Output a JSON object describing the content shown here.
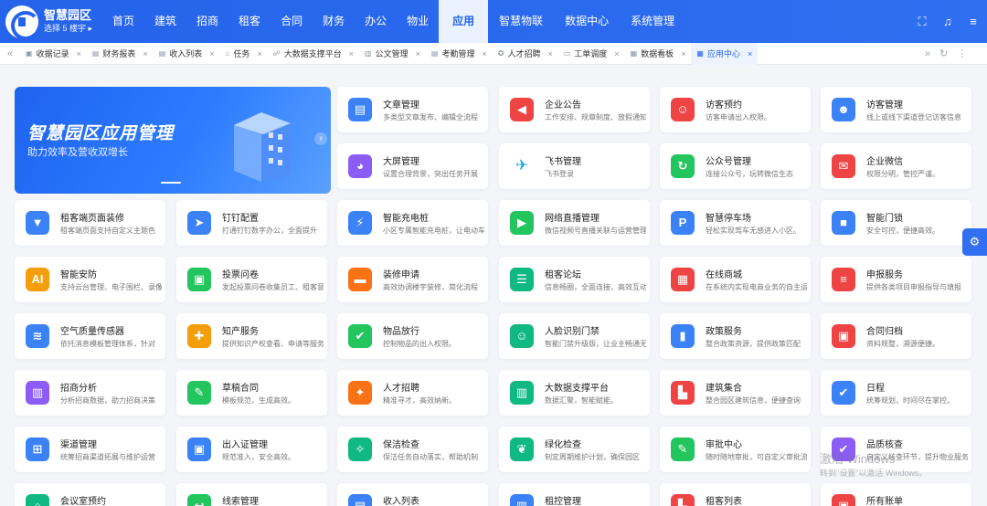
{
  "brand": {
    "title": "智慧园区",
    "subtitle": "选择 5 楼宇 ▸"
  },
  "nav": [
    "首页",
    "建筑",
    "招商",
    "租客",
    "合同",
    "财务",
    "办公",
    "物业",
    "应用",
    "智慧物联",
    "数据中心",
    "系统管理"
  ],
  "nav_active": "应用",
  "tabs": [
    {
      "icon": "▣",
      "label": "收据记录"
    },
    {
      "icon": "▤",
      "label": "财务报表"
    },
    {
      "icon": "▤",
      "label": "收入列表"
    },
    {
      "icon": "⌂",
      "label": "任务"
    },
    {
      "icon": "☍",
      "label": "大数据支撑平台"
    },
    {
      "icon": "▥",
      "label": "公文管理"
    },
    {
      "icon": "▤",
      "label": "考勤管理"
    },
    {
      "icon": "✪",
      "label": "人才招聘"
    },
    {
      "icon": "▭",
      "label": "工单调度"
    },
    {
      "icon": "▦",
      "label": "数据看板"
    },
    {
      "icon": "▦",
      "label": "应用中心",
      "active": true
    }
  ],
  "banner": {
    "title": "智慧园区应用管理",
    "subtitle": "助力效率及营收双增长"
  },
  "cards": [
    {
      "title": "文章管理",
      "desc": "多类型文章发布、编辑全流程",
      "color": "#3b82f6",
      "icon": "book-icon",
      "glyph": "▤"
    },
    {
      "title": "企业公告",
      "desc": "工作安排、规章制度、放假通知",
      "color": "#ef4444",
      "icon": "megaphone-icon",
      "glyph": "◀"
    },
    {
      "title": "访客预约",
      "desc": "访客申请出入权限。",
      "color": "#ef4444",
      "icon": "visitor-icon",
      "glyph": "☺"
    },
    {
      "title": "访客管理",
      "desc": "线上或线下渠道登记访客信息",
      "color": "#3b82f6",
      "icon": "visitor-manage-icon",
      "glyph": "☻"
    },
    {
      "title": "大屏管理",
      "desc": "设置合理背景，突出任务开展",
      "color": "#8b5cf6",
      "icon": "palette-icon",
      "glyph": "◕"
    },
    {
      "title": "飞书管理",
      "desc": "飞书登录",
      "color": "#ffffff",
      "icon": "feishu-icon",
      "glyph": "✈"
    },
    {
      "title": "公众号管理",
      "desc": "连接公众号，玩转微信生态",
      "color": "#22c55e",
      "icon": "wechat-official-icon",
      "glyph": "↻"
    },
    {
      "title": "企业微信",
      "desc": "权限分明，管控严谨。",
      "color": "#ef4444",
      "icon": "wecom-icon",
      "glyph": "✉"
    },
    {
      "title": "租客端页面装修",
      "desc": "租客端页面支持自定义主题色",
      "color": "#3b82f6",
      "icon": "brush-icon",
      "glyph": "▼"
    },
    {
      "title": "钉钉配置",
      "desc": "打通钉钉数字办公，全面提升",
      "color": "#3b82f6",
      "icon": "dingtalk-icon",
      "glyph": "➤"
    },
    {
      "title": "智能充电桩",
      "desc": "小区专属智能充电桩，让电动车",
      "color": "#3b82f6",
      "icon": "charger-icon",
      "glyph": "⚡"
    },
    {
      "title": "网络直播管理",
      "desc": "微信视频号直播关联与运营管理",
      "color": "#22c55e",
      "icon": "live-icon",
      "glyph": "▶"
    },
    {
      "title": "智慧停车场",
      "desc": "轻松实现驾车无感进入小区。",
      "color": "#3b82f6",
      "icon": "parking-icon",
      "glyph": "P"
    },
    {
      "title": "智能门锁",
      "desc": "安全可控，便捷高效。",
      "color": "#3b82f6",
      "icon": "lock-icon",
      "glyph": "■"
    },
    {
      "title": "智能安防",
      "desc": "支持云台管理、电子围栏、录像",
      "color": "#f59e0b",
      "icon": "security-icon",
      "glyph": "AI"
    },
    {
      "title": "投票问卷",
      "desc": "发起投票问卷收集员工、租客意见",
      "color": "#22c55e",
      "icon": "vote-icon",
      "glyph": "▣"
    },
    {
      "title": "装修申请",
      "desc": "高效协调楼宇装修，简化流程",
      "color": "#f97316",
      "icon": "paint-roller-icon",
      "glyph": "▬"
    },
    {
      "title": "租客论坛",
      "desc": "信息畅圈，全面连接，高效互动",
      "color": "#10b981",
      "icon": "forum-icon",
      "glyph": "☰"
    },
    {
      "title": "在线商城",
      "desc": "在系统内实现电商业务的自主运营",
      "color": "#ef4444",
      "icon": "shop-icon",
      "glyph": "▦"
    },
    {
      "title": "申报服务",
      "desc": "提供各类项目申报指导与填报",
      "color": "#ef4444",
      "icon": "declare-icon",
      "glyph": "≡"
    },
    {
      "title": "空气质量传感器",
      "desc": "依托消息模板管理体系，针对",
      "color": "#3b82f6",
      "icon": "air-sensor-icon",
      "glyph": "≋"
    },
    {
      "title": "知产服务",
      "desc": "提供知识产权查看、申请等服务",
      "color": "#f59e0b",
      "icon": "ip-service-icon",
      "glyph": "✚"
    },
    {
      "title": "物品放行",
      "desc": "控制物品的出入权限。",
      "color": "#22c55e",
      "icon": "release-icon",
      "glyph": "✔"
    },
    {
      "title": "人脸识别门禁",
      "desc": "智能门禁升级版，让业主畅通无阻",
      "color": "#10b981",
      "icon": "face-id-icon",
      "glyph": "☺"
    },
    {
      "title": "政策服务",
      "desc": "整合政策资源，提供政策匹配",
      "color": "#3b82f6",
      "icon": "policy-icon",
      "glyph": "▮"
    },
    {
      "title": "合同归档",
      "desc": "资料规整，溯源便捷。",
      "color": "#ef4444",
      "icon": "archive-icon",
      "glyph": "▣"
    },
    {
      "title": "招商分析",
      "desc": "分析招商数据，助力招商决策",
      "color": "#8b5cf6",
      "icon": "analysis-icon",
      "glyph": "▥"
    },
    {
      "title": "草稿合同",
      "desc": "模板规范，生成高效。",
      "color": "#22c55e",
      "icon": "draft-icon",
      "glyph": "✎"
    },
    {
      "title": "人才招聘",
      "desc": "精准寻才，高效纳新。",
      "color": "#f97316",
      "icon": "recruit-icon",
      "glyph": "✦"
    },
    {
      "title": "大数据支撑平台",
      "desc": "数据汇聚，智能赋能。",
      "color": "#10b981",
      "icon": "bigdata-icon",
      "glyph": "▥"
    },
    {
      "title": "建筑集合",
      "desc": "整合园区建筑信息，便捷查询",
      "color": "#ef4444",
      "icon": "building-icon",
      "glyph": "▙"
    },
    {
      "title": "日程",
      "desc": "统筹规划，时间尽在掌控。",
      "color": "#3b82f6",
      "icon": "calendar-icon",
      "glyph": "✔"
    },
    {
      "title": "渠道管理",
      "desc": "统筹招商渠道拓展与维护运营",
      "color": "#3b82f6",
      "icon": "channel-icon",
      "glyph": "⊞"
    },
    {
      "title": "出入证管理",
      "desc": "规范准入，安全高效。",
      "color": "#3b82f6",
      "icon": "pass-icon",
      "glyph": "▣"
    },
    {
      "title": "保洁检查",
      "desc": "保洁任务自动落实，帮助机制",
      "color": "#10b981",
      "icon": "broom-icon",
      "glyph": "✧"
    },
    {
      "title": "绿化检查",
      "desc": "制定周期维护计划，确保园区",
      "color": "#10b981",
      "icon": "leaf-icon",
      "glyph": "❦"
    },
    {
      "title": "审批中心",
      "desc": "随时随地审批，可自定义审批流",
      "color": "#22c55e",
      "icon": "approval-icon",
      "glyph": "✎"
    },
    {
      "title": "品质核查",
      "desc": "自定义核查环节，提升物业服务",
      "color": "#8b5cf6",
      "icon": "quality-icon",
      "glyph": "✔"
    },
    {
      "title": "会议室预约",
      "desc": "",
      "color": "#10b981",
      "icon": "meeting-room-icon",
      "glyph": "⌂"
    },
    {
      "title": "线索管理",
      "desc": "",
      "color": "#22c55e",
      "icon": "lead-icon",
      "glyph": "↩"
    },
    {
      "title": "收入列表",
      "desc": "",
      "color": "#3b82f6",
      "icon": "income-icon",
      "glyph": "▤"
    },
    {
      "title": "租控管理",
      "desc": "",
      "color": "#3b82f6",
      "icon": "rent-control-icon",
      "glyph": "▥"
    },
    {
      "title": "租客列表",
      "desc": "",
      "color": "#ef4444",
      "icon": "tenant-list-icon",
      "glyph": "▙"
    },
    {
      "title": "所有账单",
      "desc": "",
      "color": "#ef4444",
      "icon": "bill-icon",
      "glyph": "▣"
    }
  ],
  "watermark": {
    "line1": "激活 Windows",
    "line2": "转到\"设置\"以激活 Windows。"
  }
}
